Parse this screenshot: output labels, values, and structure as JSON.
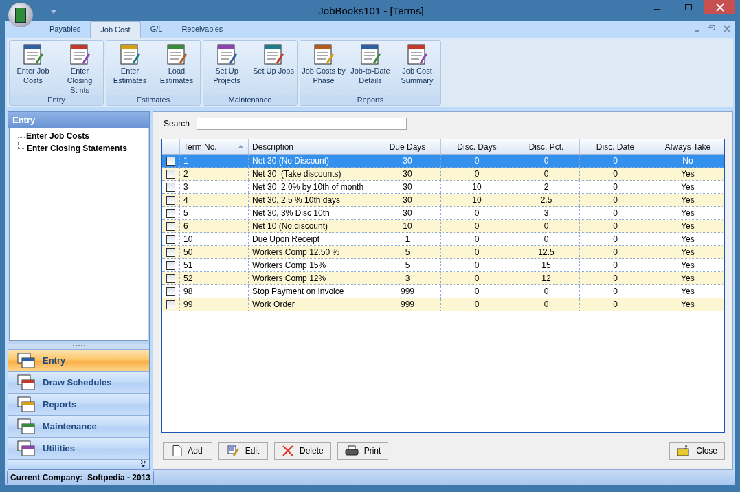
{
  "window": {
    "title": "JobBooks101 - [Terms]"
  },
  "ribbon_tabs": [
    {
      "label": "Payables",
      "selected": false
    },
    {
      "label": "Job Cost",
      "selected": true
    },
    {
      "label": "G/L",
      "selected": false
    },
    {
      "label": "Receivables",
      "selected": false
    }
  ],
  "ribbon_groups": [
    {
      "label": "Entry",
      "buttons": [
        {
          "label": "Enter Job Costs"
        },
        {
          "label": "Enter Closing Stmts"
        }
      ]
    },
    {
      "label": "Estimates",
      "buttons": [
        {
          "label": "Enter Estimates"
        },
        {
          "label": "Load Estimates"
        }
      ]
    },
    {
      "label": "Maintenance",
      "buttons": [
        {
          "label": "Set Up Projects"
        },
        {
          "label": "Set Up Jobs"
        }
      ]
    },
    {
      "label": "Reports",
      "buttons": [
        {
          "label": "Job Costs by Phase"
        },
        {
          "label": "Job-to-Date Details"
        },
        {
          "label": "Job Cost Summary"
        }
      ]
    }
  ],
  "sidebar": {
    "title": "Entry",
    "tree_items": [
      {
        "label": "Enter Job Costs"
      },
      {
        "label": "Enter Closing Statements"
      }
    ],
    "nav_items": [
      {
        "label": "Entry",
        "selected": true
      },
      {
        "label": "Draw Schedules",
        "selected": false
      },
      {
        "label": "Reports",
        "selected": false
      },
      {
        "label": "Maintenance",
        "selected": false
      },
      {
        "label": "Utilities",
        "selected": false
      }
    ]
  },
  "search": {
    "label": "Search"
  },
  "table": {
    "columns": [
      {
        "label": "Term No.",
        "sorted": true
      },
      {
        "label": "Description",
        "sorted": false
      },
      {
        "label": "Due Days",
        "sorted": false
      },
      {
        "label": "Disc. Days",
        "sorted": false
      },
      {
        "label": "Disc. Pct.",
        "sorted": false
      },
      {
        "label": "Disc. Date",
        "sorted": false
      },
      {
        "label": "Always Take",
        "sorted": false
      }
    ],
    "rows": [
      {
        "selected": true,
        "checked": false,
        "cells": [
          "1",
          "Net 30 (No Discount)",
          "30",
          "0",
          "0",
          "0",
          "No"
        ]
      },
      {
        "selected": false,
        "checked": false,
        "cells": [
          "2",
          "Net 30  (Take discounts)",
          "30",
          "0",
          "0",
          "0",
          "Yes"
        ]
      },
      {
        "selected": false,
        "checked": false,
        "cells": [
          "3",
          "Net 30  2.0% by 10th of month",
          "30",
          "10",
          "2",
          "0",
          "Yes"
        ]
      },
      {
        "selected": false,
        "checked": false,
        "cells": [
          "4",
          "Net 30, 2.5 % 10th days",
          "30",
          "10",
          "2.5",
          "0",
          "Yes"
        ]
      },
      {
        "selected": false,
        "checked": false,
        "cells": [
          "5",
          "Net 30, 3% Disc 10th",
          "30",
          "0",
          "3",
          "0",
          "Yes"
        ]
      },
      {
        "selected": false,
        "checked": false,
        "cells": [
          "6",
          "Net 10 (No discount)",
          "10",
          "0",
          "0",
          "0",
          "Yes"
        ]
      },
      {
        "selected": false,
        "checked": false,
        "cells": [
          "10",
          "Due Upon Receipt",
          "1",
          "0",
          "0",
          "0",
          "Yes"
        ]
      },
      {
        "selected": false,
        "checked": false,
        "cells": [
          "50",
          "Workers Comp 12.50 %",
          "5",
          "0",
          "12.5",
          "0",
          "Yes"
        ]
      },
      {
        "selected": false,
        "checked": false,
        "cells": [
          "51",
          "Workers Comp 15%",
          "5",
          "0",
          "15",
          "0",
          "Yes"
        ]
      },
      {
        "selected": false,
        "checked": false,
        "cells": [
          "52",
          "Workers Comp 12%",
          "3",
          "0",
          "12",
          "0",
          "Yes"
        ]
      },
      {
        "selected": false,
        "checked": false,
        "cells": [
          "98",
          "Stop Payment on Invoice",
          "999",
          "0",
          "0",
          "0",
          "Yes"
        ]
      },
      {
        "selected": false,
        "checked": false,
        "cells": [
          "99",
          "Work Order",
          "999",
          "0",
          "0",
          "0",
          "Yes"
        ]
      }
    ]
  },
  "buttons": [
    {
      "label": "Add"
    },
    {
      "label": "Edit"
    },
    {
      "label": "Delete"
    },
    {
      "label": "Print"
    }
  ],
  "close_button": {
    "label": "Close"
  },
  "status_bar": {
    "text": "Current Company:  Softpedia - 2013"
  }
}
